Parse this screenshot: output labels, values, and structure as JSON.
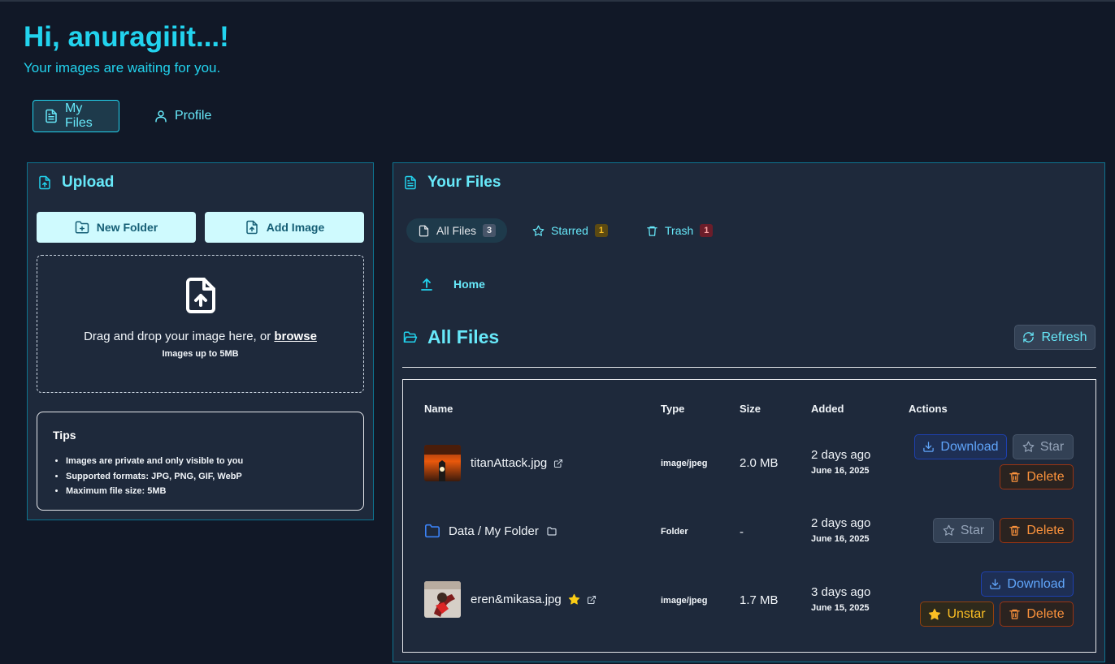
{
  "header": {
    "greeting": "Hi, anuragiiit...!",
    "subtitle": "Your images are waiting for you."
  },
  "nav": {
    "tabs": [
      {
        "label": "My Files",
        "icon": "file-text-icon",
        "active": true
      },
      {
        "label": "Profile",
        "icon": "user-icon",
        "active": false
      }
    ]
  },
  "upload": {
    "title": "Upload",
    "new_folder_label": "New Folder",
    "add_image_label": "Add Image",
    "dropzone": {
      "text": "Drag and drop your image here, or",
      "browse": "browse",
      "limit": "Images up to 5MB"
    },
    "tips": {
      "title": "Tips",
      "items": [
        "Images are private and only visible to you",
        "Supported formats: JPG, PNG, GIF, WebP",
        "Maximum file size: 5MB"
      ]
    }
  },
  "files": {
    "title": "Your Files",
    "tabs": [
      {
        "label": "All Files",
        "count": "3",
        "active": true
      },
      {
        "label": "Starred",
        "count": "1",
        "active": false
      },
      {
        "label": "Trash",
        "count": "1",
        "active": false
      }
    ],
    "breadcrumb": "Home",
    "section_title": "All Files",
    "refresh_label": "Refresh",
    "columns": [
      "Name",
      "Type",
      "Size",
      "Added",
      "Actions"
    ],
    "rows": [
      {
        "name": "titanAttack.jpg",
        "type": "image/jpeg",
        "size": "2.0 MB",
        "added_relative": "2 days ago",
        "added_date": "June 16, 2025",
        "starred": false,
        "actions": [
          "Download",
          "Star",
          "Delete"
        ]
      },
      {
        "name": "Data / My Folder",
        "type": "Folder",
        "size": "-",
        "added_relative": "2 days ago",
        "added_date": "June 16, 2025",
        "starred": false,
        "actions": [
          "Star",
          "Delete"
        ]
      },
      {
        "name": "eren&mikasa.jpg",
        "type": "image/jpeg",
        "size": "1.7 MB",
        "added_relative": "3 days ago",
        "added_date": "June 15, 2025",
        "starred": true,
        "actions": [
          "Download",
          "Unstar",
          "Delete"
        ]
      }
    ]
  },
  "colors": {
    "background": "#111827",
    "panel": "#1e293b",
    "accent": "#22d3ee",
    "download": "#60a5fa",
    "delete": "#fb923c",
    "star": "#fbbf24"
  }
}
